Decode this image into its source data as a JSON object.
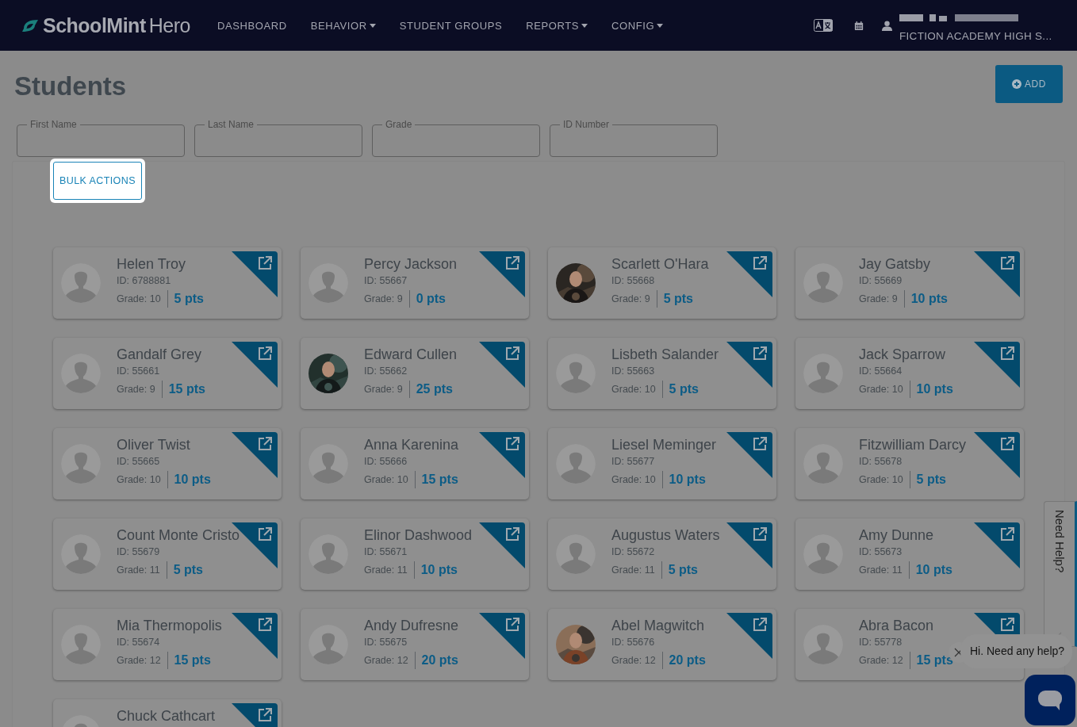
{
  "header": {
    "logo": {
      "brand": "SchoolMint",
      "product": "Hero"
    },
    "nav": [
      {
        "label": "DASHBOARD",
        "dropdown": false
      },
      {
        "label": "BEHAVIOR",
        "dropdown": true
      },
      {
        "label": "STUDENT GROUPS",
        "dropdown": false
      },
      {
        "label": "REPORTS",
        "dropdown": true
      },
      {
        "label": "CONFIG",
        "dropdown": true
      }
    ],
    "school": "FICTION ACADEMY HIGH S..."
  },
  "page": {
    "title": "Students",
    "add_button": "ADD"
  },
  "filters": [
    {
      "label": "First Name"
    },
    {
      "label": "Last Name"
    },
    {
      "label": "Grade"
    },
    {
      "label": "ID Number"
    }
  ],
  "bulk_actions": "BULK ACTIONS",
  "students": [
    {
      "name": "Helen Troy",
      "id": "ID: 6788881",
      "grade": "Grade: 10",
      "points": "5 pts",
      "kind": "silhouette"
    },
    {
      "name": "Percy Jackson",
      "id": "ID: 55667",
      "grade": "Grade: 9",
      "points": "0 pts",
      "kind": "silhouette"
    },
    {
      "name": "Scarlett O'Hara",
      "id": "ID: 55668",
      "grade": "Grade: 9",
      "points": "5 pts"
    },
    {
      "name": "Jay Gatsby",
      "id": "ID: 55669",
      "grade": "Grade: 9",
      "points": "10 pts",
      "kind": "silhouette"
    },
    {
      "name": "Gandalf Grey",
      "id": "ID: 55661",
      "grade": "Grade: 9",
      "points": "15 pts",
      "kind": "silhouette"
    },
    {
      "name": "Edward Cullen",
      "id": "ID: 55662",
      "grade": "Grade: 9",
      "points": "25 pts"
    },
    {
      "name": "Lisbeth Salander",
      "id": "ID: 55663",
      "grade": "Grade: 10",
      "points": "5 pts",
      "kind": "silhouette"
    },
    {
      "name": "Jack Sparrow",
      "id": "ID: 55664",
      "grade": "Grade: 10",
      "points": "10 pts",
      "kind": "silhouette"
    },
    {
      "name": "Oliver Twist",
      "id": "ID: 55665",
      "grade": "Grade: 10",
      "points": "10 pts",
      "kind": "silhouette"
    },
    {
      "name": "Anna Karenina",
      "id": "ID: 55666",
      "grade": "Grade: 10",
      "points": "15 pts",
      "kind": "silhouette"
    },
    {
      "name": "Liesel Meminger",
      "id": "ID: 55677",
      "grade": "Grade: 10",
      "points": "10 pts",
      "kind": "silhouette"
    },
    {
      "name": "Fitzwilliam Darcy",
      "id": "ID: 55678",
      "grade": "Grade: 10",
      "points": "5 pts",
      "kind": "silhouette"
    },
    {
      "name": "Count Monte Cristo",
      "id": "ID: 55679",
      "grade": "Grade: 11",
      "points": "5 pts",
      "kind": "silhouette"
    },
    {
      "name": "Elinor Dashwood",
      "id": "ID: 55671",
      "grade": "Grade: 11",
      "points": "10 pts",
      "kind": "silhouette"
    },
    {
      "name": "Augustus Waters",
      "id": "ID: 55672",
      "grade": "Grade: 11",
      "points": "5 pts",
      "kind": "silhouette"
    },
    {
      "name": "Amy Dunne",
      "id": "ID: 55673",
      "grade": "Grade: 11",
      "points": "10 pts",
      "kind": "silhouette"
    },
    {
      "name": "Mia Thermopolis",
      "id": "ID: 55674",
      "grade": "Grade: 12",
      "points": "15 pts",
      "kind": "silhouette"
    },
    {
      "name": "Andy Dufresne",
      "id": "ID: 55675",
      "grade": "Grade: 12",
      "points": "20 pts",
      "kind": "silhouette"
    },
    {
      "name": "Abel Magwitch",
      "id": "ID: 55676",
      "grade": "Grade: 12",
      "points": "20 pts"
    },
    {
      "name": "Abra Bacon",
      "id": "ID: 55778",
      "grade": "Grade: 12",
      "points": "15 pts",
      "kind": "silhouette"
    },
    {
      "name": "Chuck Cathcart",
      "kind": "silhouette"
    }
  ],
  "help_tab": "Need Help?",
  "chat": {
    "message": "Hi. Need any help?"
  }
}
